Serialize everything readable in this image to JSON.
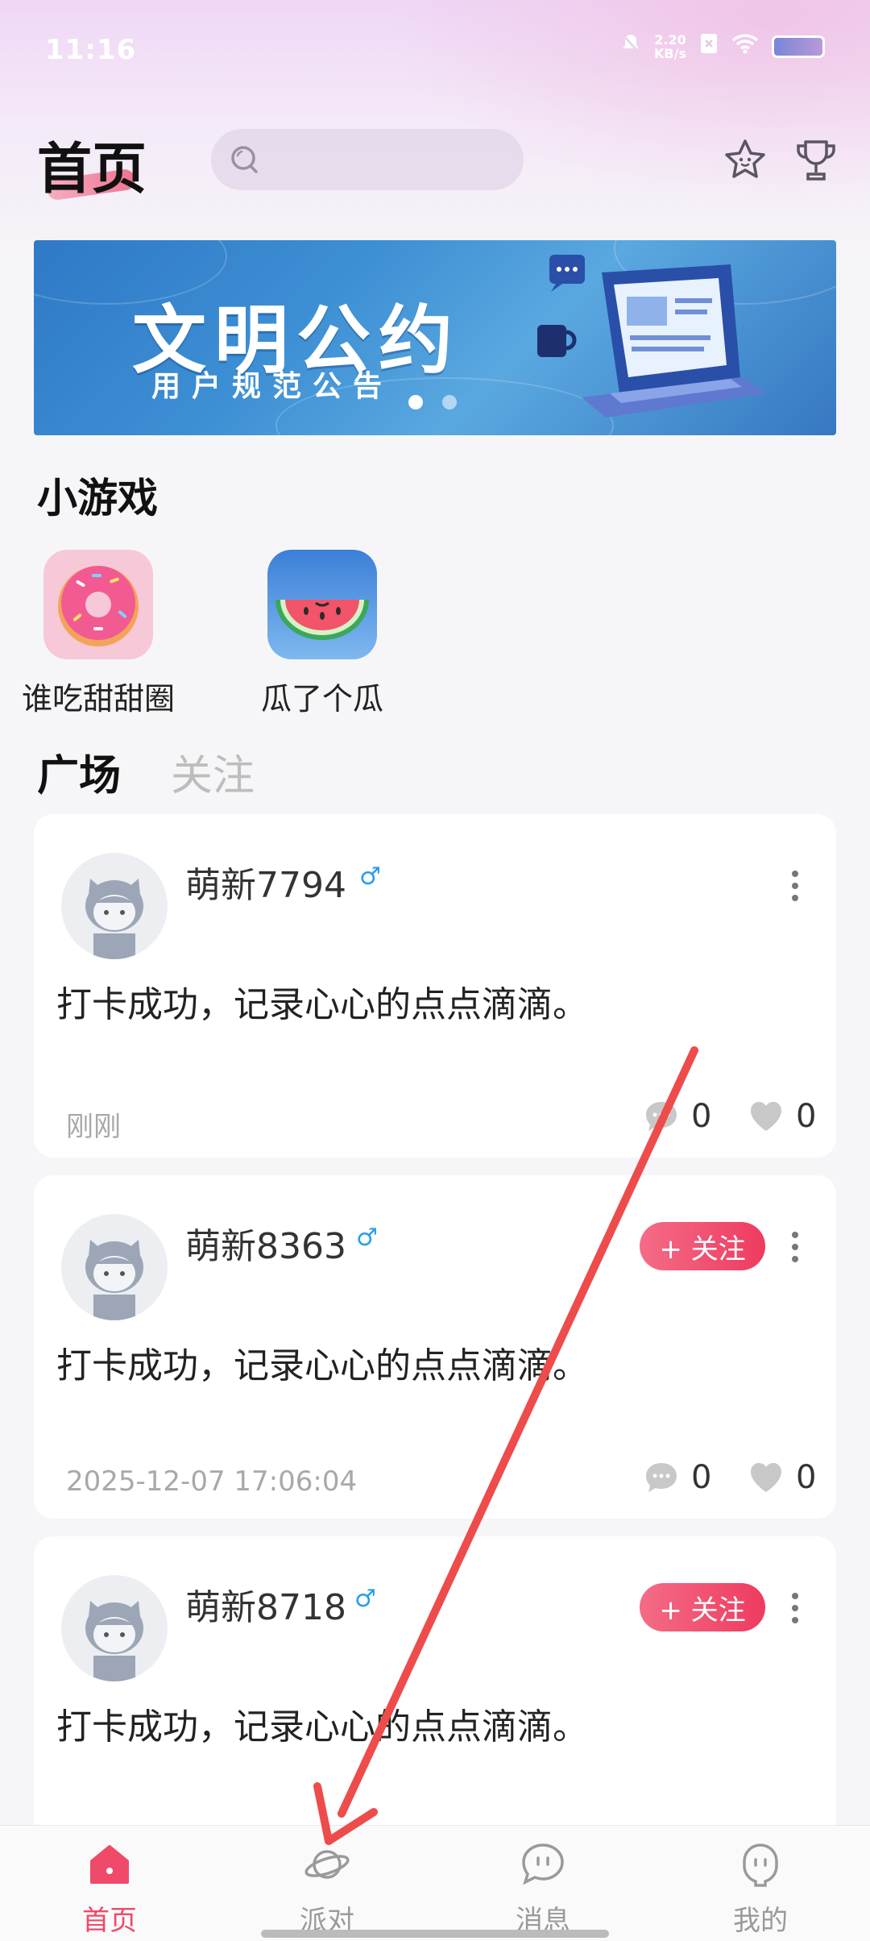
{
  "status_bar": {
    "time": "11:16",
    "net_speed_value": "2.20",
    "net_speed_unit": "KB/s"
  },
  "header": {
    "title": "首页",
    "search_placeholder": ""
  },
  "banner": {
    "title": "文明公约",
    "subtitle": "用户规范公告",
    "dots": 2,
    "active_dot": 1
  },
  "mini_games": {
    "title": "小游戏",
    "items": [
      {
        "name": "谁吃甜甜圈",
        "icon": "donut-icon"
      },
      {
        "name": "瓜了个瓜",
        "icon": "watermelon-icon"
      }
    ]
  },
  "feed_tabs": [
    {
      "label": "广场",
      "active": true
    },
    {
      "label": "关注",
      "active": false
    }
  ],
  "posts": [
    {
      "username": "萌新7794",
      "gender": "♂",
      "text": "打卡成功，记录心心的点点滴滴。",
      "time": "刚刚",
      "comments": "0",
      "likes": "0",
      "show_follow": false
    },
    {
      "username": "萌新8363",
      "gender": "♂",
      "text": "打卡成功，记录心心的点点滴滴。",
      "time": "2025-12-07 17:06:04",
      "comments": "0",
      "likes": "0",
      "show_follow": true,
      "follow_label": "+ 关注"
    },
    {
      "username": "萌新8718",
      "gender": "♂",
      "text": "打卡成功，记录心心的点点滴滴。",
      "show_follow": true,
      "follow_label": "+ 关注"
    }
  ],
  "bottom_nav": [
    {
      "label": "首页",
      "icon": "home-icon",
      "active": true
    },
    {
      "label": "派对",
      "icon": "planet-icon",
      "active": false
    },
    {
      "label": "消息",
      "icon": "message-icon",
      "active": false
    },
    {
      "label": "我的",
      "icon": "profile-icon",
      "active": false
    }
  ],
  "colors": {
    "accent": "#ef4a6a",
    "gender_male": "#2b9ee8",
    "annotation_arrow": "#ee4b4b"
  }
}
